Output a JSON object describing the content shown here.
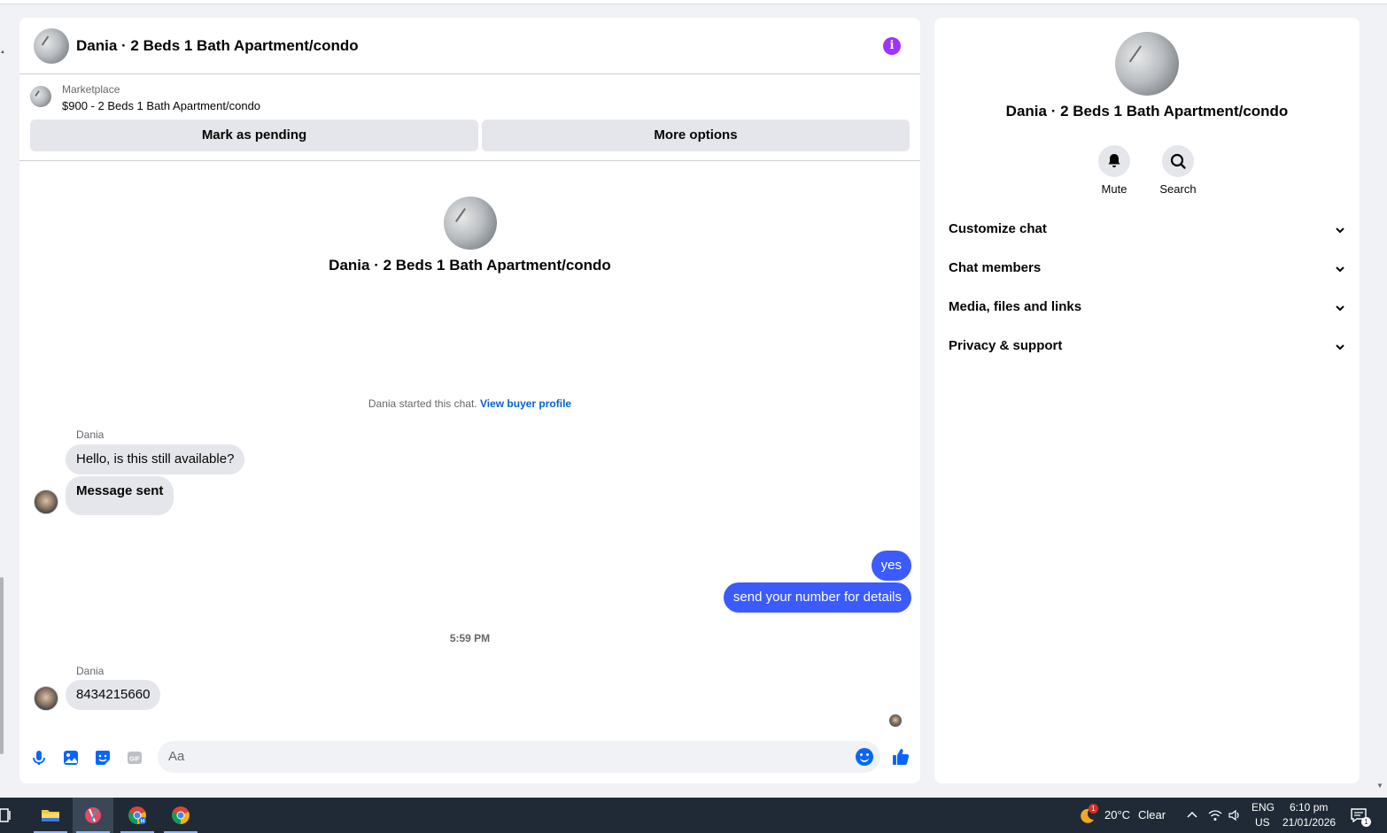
{
  "chat": {
    "title": "Dania · 2 Beds 1 Bath Apartment/condo",
    "marketplace_label": "Marketplace",
    "listing": "$900 - 2 Beds 1 Bath Apartment/condo",
    "mark_pending_label": "Mark as pending",
    "more_options_label": "More options",
    "center_title": "Dania · 2 Beds 1 Bath Apartment/condo",
    "started_text": "Dania started this chat.",
    "view_profile_link": "View buyer profile"
  },
  "messages": {
    "group1": {
      "sender": "Dania",
      "msg1": "Hello, is this still available?",
      "msg2": "Message sent"
    },
    "outgoing": {
      "msg1": "yes",
      "msg2": "send your number for details"
    },
    "time_separator": "5:59 PM",
    "group2": {
      "sender": "Dania",
      "msg1": "8434215660"
    }
  },
  "composer": {
    "placeholder": "Aa",
    "icons": [
      "microphone-icon",
      "image-icon",
      "sticker-icon",
      "gif-icon",
      "emoji-icon",
      "thumbs-up-icon"
    ]
  },
  "info_panel": {
    "title": "Dania · 2 Beds 1 Bath Apartment/condo",
    "mute_label": "Mute",
    "search_label": "Search",
    "sections": {
      "customize": "Customize chat",
      "members": "Chat members",
      "media": "Media, files and links",
      "privacy": "Privacy & support"
    }
  },
  "taskbar": {
    "weather_badge": "1",
    "temperature": "20°C",
    "condition": "Clear",
    "language": "ENG",
    "region": "US",
    "time": "6:10 pm",
    "date": "21/01/2026",
    "notification_count": "1"
  },
  "colors": {
    "accent_blue": "#0866ff",
    "outgoing_bubble": "#3b5bfd",
    "info_purple": "#a033ff",
    "link_blue": "#0064d1"
  }
}
